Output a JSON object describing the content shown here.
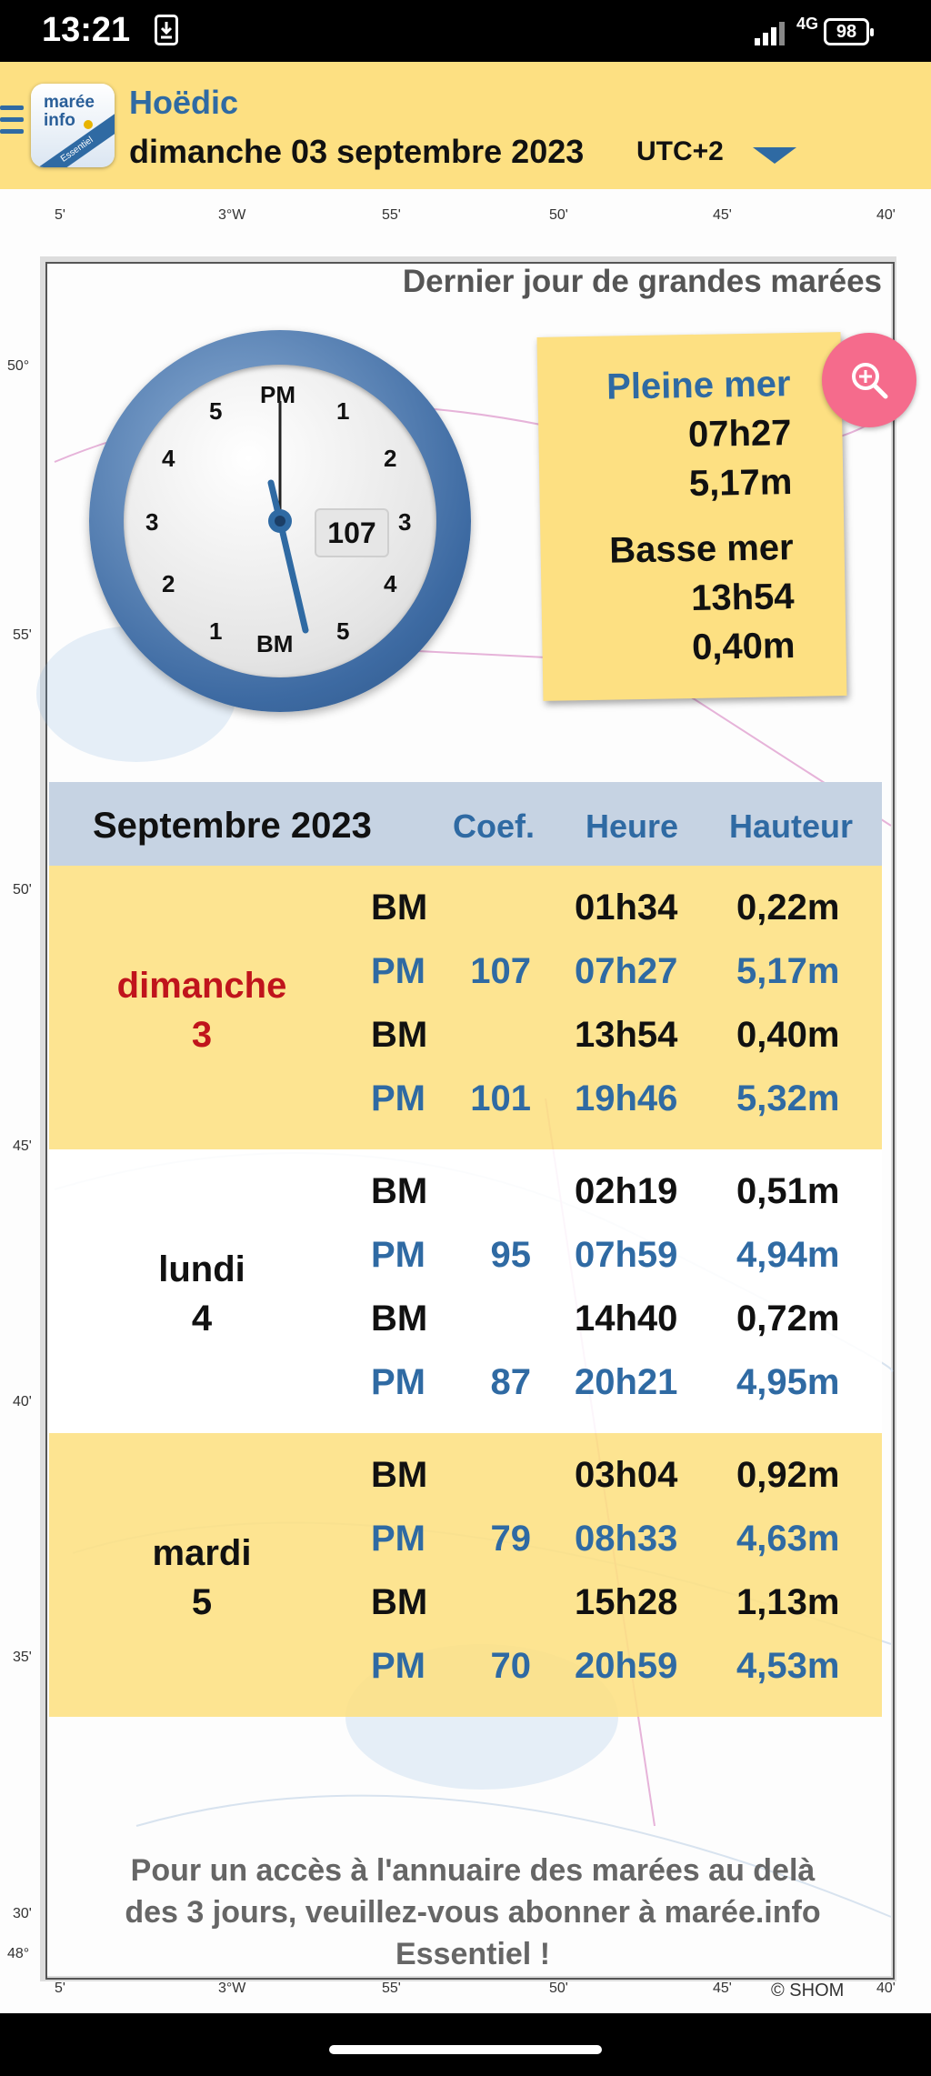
{
  "status_bar": {
    "time": "13:21",
    "network": "4G",
    "battery": "98"
  },
  "header": {
    "location": "Hoëdic",
    "date": "dimanche 03 septembre 2023",
    "timezone": "UTC+2",
    "logo_line1": "marée",
    "logo_line2": "info",
    "logo_band": "Essentiel"
  },
  "banner": "Dernier jour de grandes marées",
  "clock": {
    "top_label": "PM",
    "bottom_label": "BM",
    "coefficient": "107",
    "numbers": [
      "5",
      "1",
      "4",
      "2",
      "3",
      "3",
      "2",
      "4",
      "1",
      "5"
    ]
  },
  "tide_card": {
    "high_label": "Pleine mer",
    "high_time": "07h27",
    "high_height": "5,17m",
    "low_label": "Basse mer",
    "low_time": "13h54",
    "low_height": "0,40m"
  },
  "table": {
    "month": "Septembre 2023",
    "col_coef": "Coef.",
    "col_time": "Heure",
    "col_height": "Hauteur",
    "days": [
      {
        "name": "dimanche",
        "num": "3",
        "rows": [
          {
            "type": "BM",
            "coef": "",
            "time": "01h34",
            "height": "0,22m"
          },
          {
            "type": "PM",
            "coef": "107",
            "time": "07h27",
            "height": "5,17m"
          },
          {
            "type": "BM",
            "coef": "",
            "time": "13h54",
            "height": "0,40m"
          },
          {
            "type": "PM",
            "coef": "101",
            "time": "19h46",
            "height": "5,32m"
          }
        ]
      },
      {
        "name": "lundi",
        "num": "4",
        "rows": [
          {
            "type": "BM",
            "coef": "",
            "time": "02h19",
            "height": "0,51m"
          },
          {
            "type": "PM",
            "coef": "95",
            "time": "07h59",
            "height": "4,94m"
          },
          {
            "type": "BM",
            "coef": "",
            "time": "14h40",
            "height": "0,72m"
          },
          {
            "type": "PM",
            "coef": "87",
            "time": "20h21",
            "height": "4,95m"
          }
        ]
      },
      {
        "name": "mardi",
        "num": "5",
        "rows": [
          {
            "type": "BM",
            "coef": "",
            "time": "03h04",
            "height": "0,92m"
          },
          {
            "type": "PM",
            "coef": "79",
            "time": "08h33",
            "height": "4,63m"
          },
          {
            "type": "BM",
            "coef": "",
            "time": "15h28",
            "height": "1,13m"
          },
          {
            "type": "PM",
            "coef": "70",
            "time": "20h59",
            "height": "4,53m"
          }
        ]
      }
    ]
  },
  "footer_message": "Pour un accès à l'annuaire des marées au delà des 3 jours, veuillez-vous abonner à marée.info Essentiel !",
  "credit": "© SHOM",
  "map_scale": {
    "top": [
      "5'",
      "3°W",
      "55'",
      "50'",
      "45'",
      "40'"
    ],
    "left": [
      "50°",
      "55'",
      "50'",
      "45'",
      "40'",
      "35'",
      "30'",
      "48°"
    ]
  },
  "colors": {
    "accent": "#2f6aa3",
    "header_bg": "#fde082",
    "today": "#c0141c",
    "zoom": "#f56b8c"
  }
}
